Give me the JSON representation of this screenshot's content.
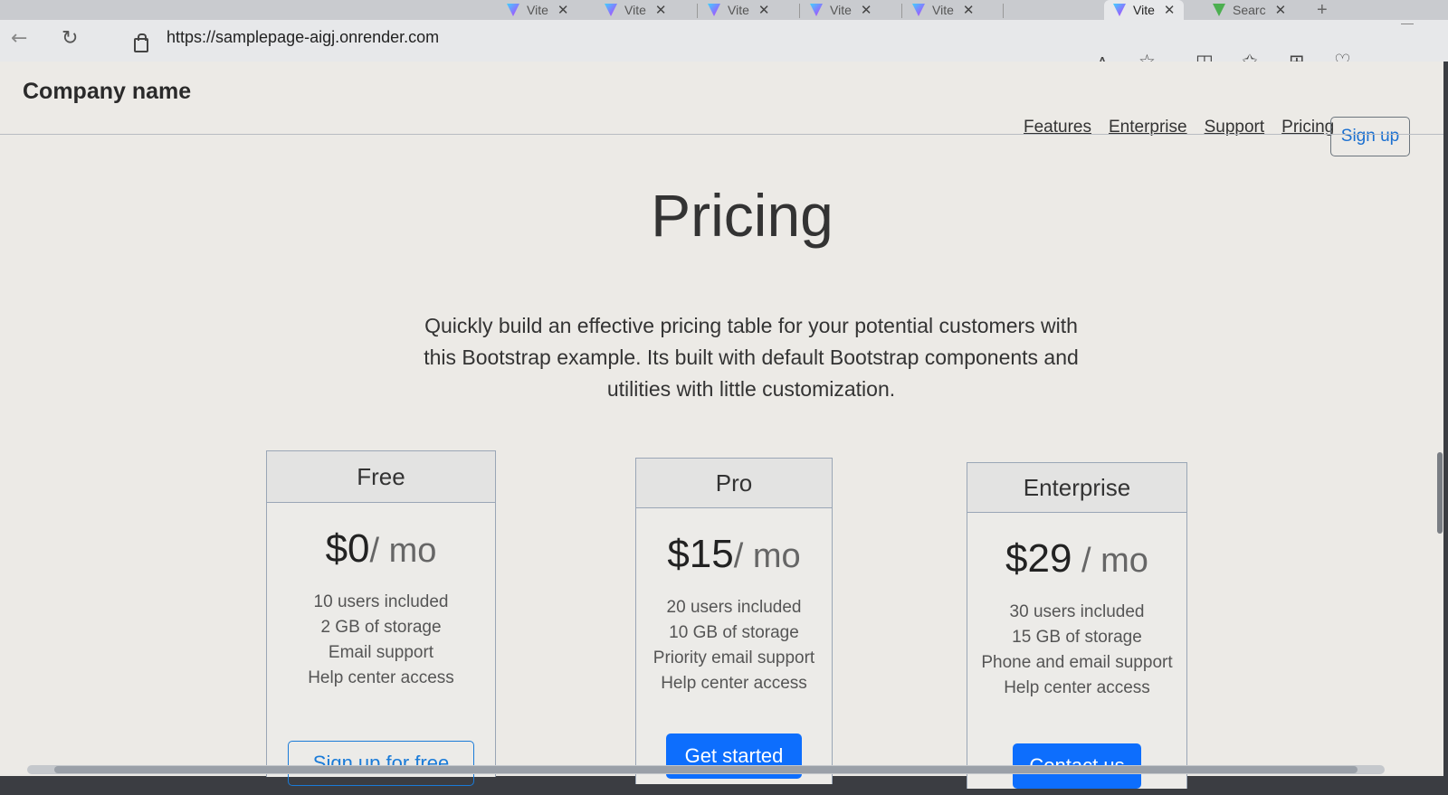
{
  "browser": {
    "tabs": [
      {
        "label": "Vite",
        "active": false
      },
      {
        "label": "Vite",
        "active": false
      },
      {
        "label": "Vite",
        "active": false
      },
      {
        "label": "Vite",
        "active": false
      },
      {
        "label": "Vite",
        "active": false
      },
      {
        "label": "Vite",
        "active": true
      },
      {
        "label": "Searc",
        "active": false
      }
    ],
    "url": "https://samplepage-aigj.onrender.com",
    "icons": [
      "back-icon",
      "refresh-icon",
      "lock-icon",
      "read-aloud-icon",
      "favorite-star-icon",
      "split-screen-icon",
      "favorites-list-icon",
      "collections-icon",
      "health-icon",
      "profile-icon"
    ]
  },
  "header": {
    "brand": "Company name",
    "nav": [
      "Features",
      "Enterprise",
      "Support",
      "Pricing"
    ],
    "signup": "Sign up"
  },
  "hero": {
    "title": "Pricing",
    "lead": "Quickly build an effective pricing table for your potential customers with this Bootstrap example. Its built with default Bootstrap components and utilities with little customization."
  },
  "plans": [
    {
      "name": "Free",
      "price": "$0",
      "period": "/ mo",
      "features": [
        "10 users included",
        "2 GB of storage",
        "Email support",
        "Help center access"
      ],
      "cta": "Sign up for free",
      "cta_style": "outline"
    },
    {
      "name": "Pro",
      "price": "$15",
      "period": "/ mo",
      "features": [
        "20 users included",
        "10 GB of storage",
        "Priority email support",
        "Help center access"
      ],
      "cta": "Get started",
      "cta_style": "solid"
    },
    {
      "name": "Enterprise",
      "price": "$29",
      "period": " / mo",
      "features": [
        "30 users included",
        "15 GB of storage",
        "Phone and email support",
        "Help center access"
      ],
      "cta": "Contact us",
      "cta_style": "solid"
    }
  ],
  "colors": {
    "primary": "#0d6efd",
    "page_background": "#eceae6"
  }
}
